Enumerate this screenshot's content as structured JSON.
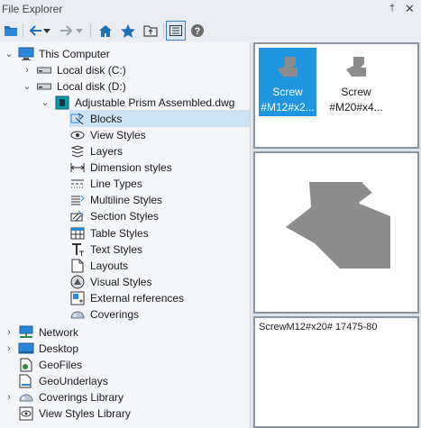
{
  "window": {
    "title": "File Explorer",
    "pin_glyph": "†",
    "close_glyph": "✕"
  },
  "toolbar": {
    "buttons": [
      {
        "name": "open-folder-icon"
      },
      {
        "name": "back-arrow-icon"
      },
      {
        "name": "back-dropdown-icon"
      },
      {
        "name": "forward-arrow-icon"
      },
      {
        "name": "forward-dropdown-icon"
      },
      {
        "name": "home-icon"
      },
      {
        "name": "favorites-star-icon"
      },
      {
        "name": "folder-up-icon"
      },
      {
        "name": "view-details-icon",
        "active": true
      },
      {
        "name": "help-icon"
      }
    ]
  },
  "tree": {
    "items": [
      {
        "label": "This Computer",
        "icon": "computer-icon",
        "expanded": true
      },
      {
        "label": "Local disk (C:)",
        "icon": "drive-icon",
        "expanded": false
      },
      {
        "label": "Local disk (D:)",
        "icon": "drive-icon",
        "expanded": true
      },
      {
        "label": "Adjustable Prism Assembled.dwg",
        "icon": "dwg-file-icon",
        "expanded": true
      },
      {
        "label": "Blocks",
        "icon": "blocks-icon",
        "selected": true
      },
      {
        "label": "View Styles",
        "icon": "view-styles-icon"
      },
      {
        "label": "Layers",
        "icon": "layers-icon"
      },
      {
        "label": "Dimension styles",
        "icon": "dimension-styles-icon"
      },
      {
        "label": "Line Types",
        "icon": "line-types-icon"
      },
      {
        "label": "Multiline Styles",
        "icon": "multiline-styles-icon"
      },
      {
        "label": "Section Styles",
        "icon": "section-styles-icon"
      },
      {
        "label": "Table Styles",
        "icon": "table-styles-icon"
      },
      {
        "label": "Text Styles",
        "icon": "text-styles-icon"
      },
      {
        "label": "Layouts",
        "icon": "layouts-icon"
      },
      {
        "label": "Visual Styles",
        "icon": "visual-styles-icon"
      },
      {
        "label": "External references",
        "icon": "external-references-icon"
      },
      {
        "label": "Coverings",
        "icon": "coverings-icon"
      },
      {
        "label": "Network",
        "icon": "network-icon",
        "expanded": false
      },
      {
        "label": "Desktop",
        "icon": "desktop-icon",
        "expanded": false
      },
      {
        "label": "GeoFiles",
        "icon": "geofiles-icon"
      },
      {
        "label": "GeoUnderlays",
        "icon": "geounderlays-icon"
      },
      {
        "label": "Coverings Library",
        "icon": "coverings-library-icon",
        "expanded": false
      },
      {
        "label": "View Styles Library",
        "icon": "view-styles-library-icon"
      }
    ]
  },
  "thumbnails": [
    {
      "line1": "Screw",
      "line2": "#M12#x2...",
      "selected": true
    },
    {
      "line1": "Screw",
      "line2": "#M20#x4...",
      "selected": false
    }
  ],
  "description": {
    "text": "ScrewM12#x20# 17475-80"
  },
  "colors": {
    "accent": "#2196e0",
    "selection": "#cce3f5",
    "preview_shape": "#8c8c8c"
  }
}
